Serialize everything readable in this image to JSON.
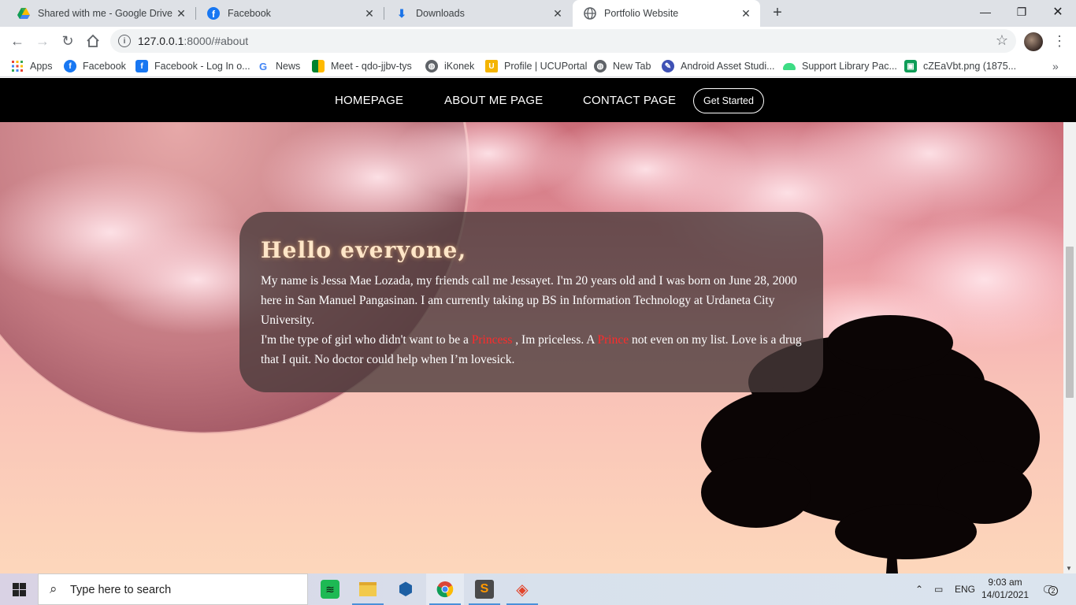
{
  "browser": {
    "tabs": [
      {
        "label": "Shared with me - Google Drive",
        "icon": "google-drive-icon",
        "active": false
      },
      {
        "label": "Facebook",
        "icon": "facebook-icon",
        "active": false
      },
      {
        "label": "Downloads",
        "icon": "download-icon",
        "active": false
      },
      {
        "label": "Portfolio Website",
        "icon": "globe-icon",
        "active": true
      }
    ],
    "url_host": "127.0.0.1",
    "url_rest": ":8000/#about",
    "bookmarks": [
      {
        "label": "Apps",
        "icon": "apps-grid-icon"
      },
      {
        "label": "Facebook",
        "icon": "facebook-icon"
      },
      {
        "label": "Facebook - Log In o...",
        "icon": "facebook-square-icon"
      },
      {
        "label": "News",
        "icon": "google-icon"
      },
      {
        "label": "Meet - qdo-jjbv-tys",
        "icon": "meet-icon"
      },
      {
        "label": "iKonek",
        "icon": "globe-icon"
      },
      {
        "label": "Profile | UCUPortal",
        "icon": "ucu-icon"
      },
      {
        "label": "New Tab",
        "icon": "globe-icon"
      },
      {
        "label": "Android Asset Studi...",
        "icon": "android-studio-icon"
      },
      {
        "label": "Support Library Pac...",
        "icon": "android-icon"
      },
      {
        "label": "cZEaVbt.png (1875...",
        "icon": "image-icon"
      }
    ]
  },
  "site": {
    "nav": {
      "home": "HOMEPAGE",
      "about": "ABOUT ME PAGE",
      "contact": "CONTACT PAGE",
      "cta": "Get Started"
    },
    "about": {
      "heading": "Hello everyone,",
      "para1": "My name is Jessa Mae Lozada, my friends call me Jessayet. I'm 20 years old and I was born on June 28, 2000 here in San Manuel Pangasinan. I am currently taking up BS in Information Technology at Urdaneta City University.",
      "para2_a": "I'm the type of girl who didn't want to be a ",
      "para2_highlight1": "Princess",
      "para2_b": " , Im priceless. A ",
      "para2_highlight2": "Prince",
      "para2_c": " not even on my list. Love is a drug that I quit. No doctor could help when I’m lovesick."
    }
  },
  "taskbar": {
    "search_placeholder": "Type here to search",
    "apps": [
      "spotify-icon",
      "file-explorer-icon",
      "virtualbox-icon",
      "chrome-icon",
      "sublime-text-icon",
      "git-icon"
    ],
    "language": "ENG",
    "time": "9:03 am",
    "date": "14/01/2021",
    "notifications": "2"
  },
  "colors": {
    "accent_red": "#ff2b2b",
    "heading_glow": "#ffe6c8",
    "nav_bg": "#000000",
    "card_bg": "#483a3a"
  }
}
